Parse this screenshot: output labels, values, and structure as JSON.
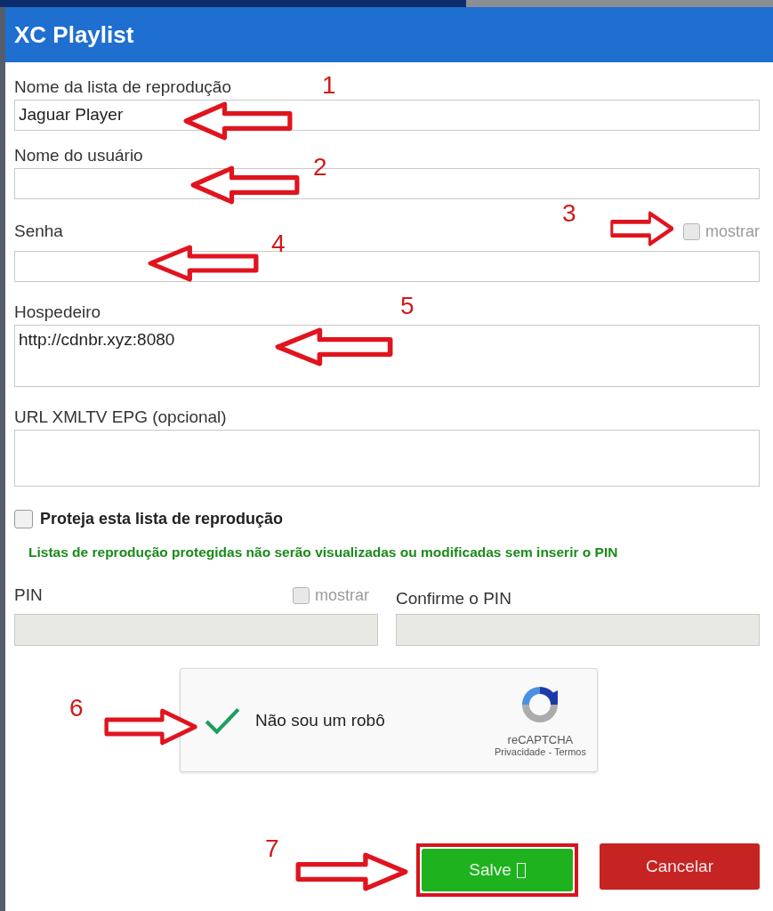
{
  "dialog": {
    "title": "XC Playlist"
  },
  "fields": [
    {
      "label": "Nome da lista de reprodução",
      "value": "Jaguar Player",
      "kind": "input"
    },
    {
      "label": "Nome do usuário",
      "kind": "input"
    },
    {
      "label": "Senha",
      "kind": "input",
      "show_toggle": {
        "label": "mostrar",
        "checked": false
      }
    },
    {
      "label": "Hospedeiro",
      "value": "http://cdnbr.xyz:8080",
      "kind": "textarea"
    },
    {
      "label": "URL XMLTV EPG (opcional)",
      "kind": "textarea"
    }
  ],
  "protect": {
    "label": "Proteja esta lista de reprodução",
    "checked": false
  },
  "notice": "Listas de reprodução protegidas não serão visualizadas ou modificadas sem inserir o PIN",
  "pin": {
    "label": "PIN",
    "disabled": true,
    "show_toggle": {
      "label": "mostrar",
      "checked": false
    }
  },
  "confirm_pin": {
    "label": "Confirme o PIN",
    "disabled": true
  },
  "captcha": {
    "label": "Não sou um robô",
    "checked": true,
    "brand": "reCAPTCHA",
    "links": "Privacidade - Termos"
  },
  "buttons": [
    {
      "label": "Salve",
      "kind": "save",
      "highlighted": true
    },
    {
      "label": "Cancelar",
      "kind": "cancel",
      "highlighted": false
    }
  ],
  "annotations": [
    {
      "number": "1",
      "kind": "left-arrow"
    },
    {
      "number": "2",
      "kind": "left-arrow"
    },
    {
      "number": "3",
      "kind": "right-arrow"
    },
    {
      "number": "4",
      "kind": "left-arrow"
    },
    {
      "number": "5",
      "kind": "left-arrow"
    },
    {
      "number": "6",
      "kind": "right-arrow"
    },
    {
      "number": "7",
      "kind": "right-arrow"
    }
  ]
}
